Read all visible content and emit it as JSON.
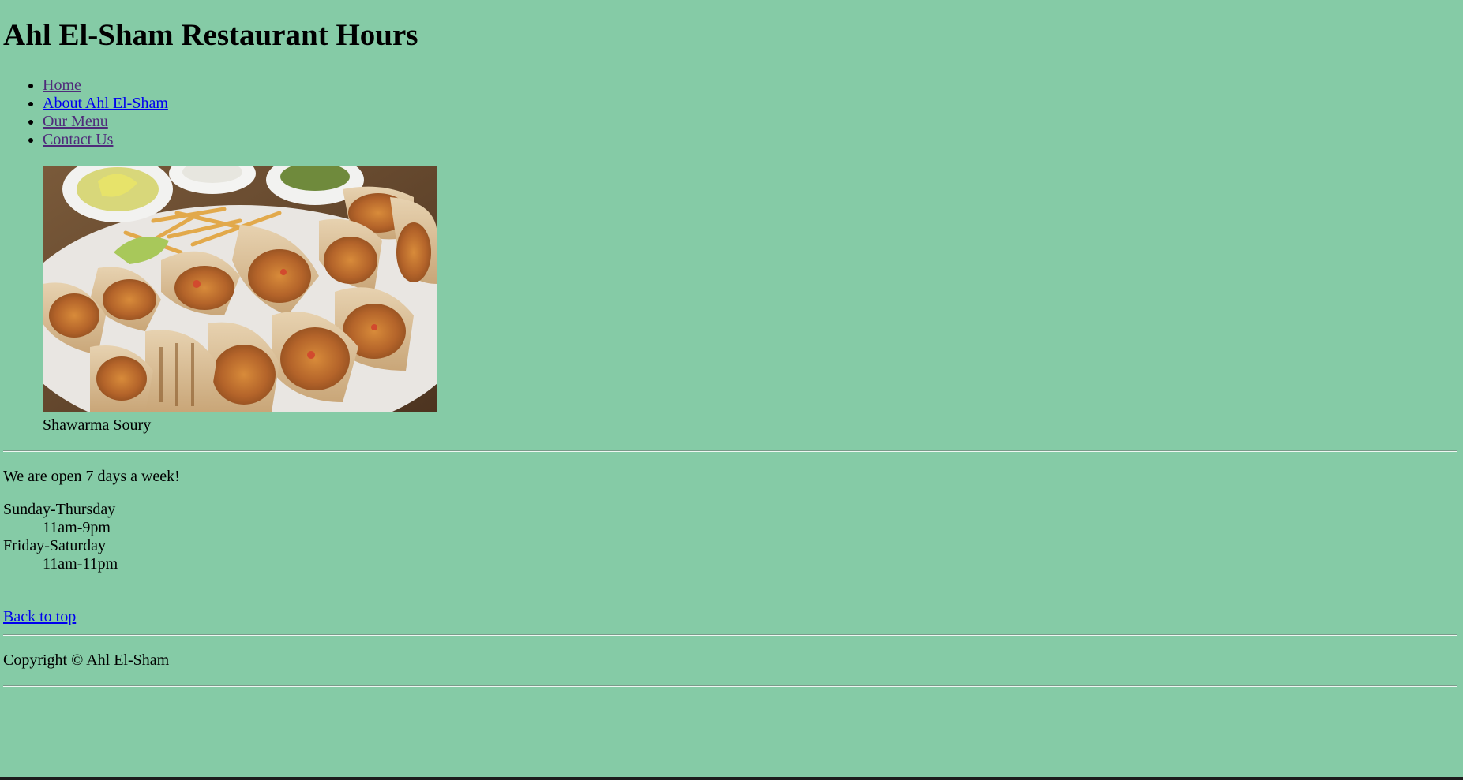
{
  "page": {
    "title": "Ahl El-Sham Restaurant Hours",
    "background_color": "#85cba6"
  },
  "nav": {
    "items": [
      {
        "label": "Home",
        "state": "visited"
      },
      {
        "label": "About Ahl El-Sham",
        "state": "unvisited"
      },
      {
        "label": "Our Menu",
        "state": "visited"
      },
      {
        "label": "Contact Us",
        "state": "visited"
      }
    ],
    "visited_color": "#4f2b7a",
    "link_color": "#0000ee"
  },
  "figure": {
    "image_subject": "platter of sliced shawarma wraps with fries and pickles",
    "caption": "Shawarma Soury"
  },
  "hours": {
    "intro": "We are open 7 days a week!",
    "schedule": [
      {
        "days": "Sunday-Thursday",
        "time": "11am-9pm"
      },
      {
        "days": "Friday-Saturday",
        "time": "11am-11pm"
      }
    ]
  },
  "footer": {
    "back_to_top": "Back to top",
    "copyright": "Copyright © Ahl El-Sham"
  }
}
